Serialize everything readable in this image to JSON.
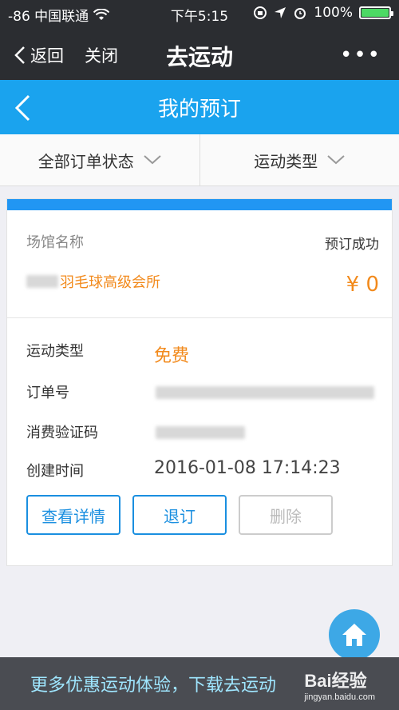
{
  "status_bar": {
    "carrier": "-86 中国联通",
    "time": "下午5:15",
    "battery": "100%"
  },
  "nav": {
    "back_label": "返回",
    "close_label": "关闭",
    "title": "去运动",
    "more": "•••"
  },
  "header": {
    "title": "我的预订"
  },
  "filters": {
    "order_status": "全部订单状态",
    "sport_type": "运动类型"
  },
  "order": {
    "venue_label": "场馆名称",
    "status": "预订成功",
    "venue_name": "羽毛球高级会所",
    "price": "¥ 0",
    "sport_type_label": "运动类型",
    "sport_type_value": "免费",
    "order_no_label": "订单号",
    "code_label": "消费验证码",
    "created_label": "创建时间",
    "created_value": "2016-01-08 17:14:23",
    "buttons": {
      "details": "查看详情",
      "cancel": "退订",
      "delete": "删除"
    }
  },
  "banner": {
    "text": "更多优惠运动体验，下载去运动"
  },
  "watermark": {
    "brand": "Bai经验",
    "url": "jingyan.baidu.com"
  }
}
